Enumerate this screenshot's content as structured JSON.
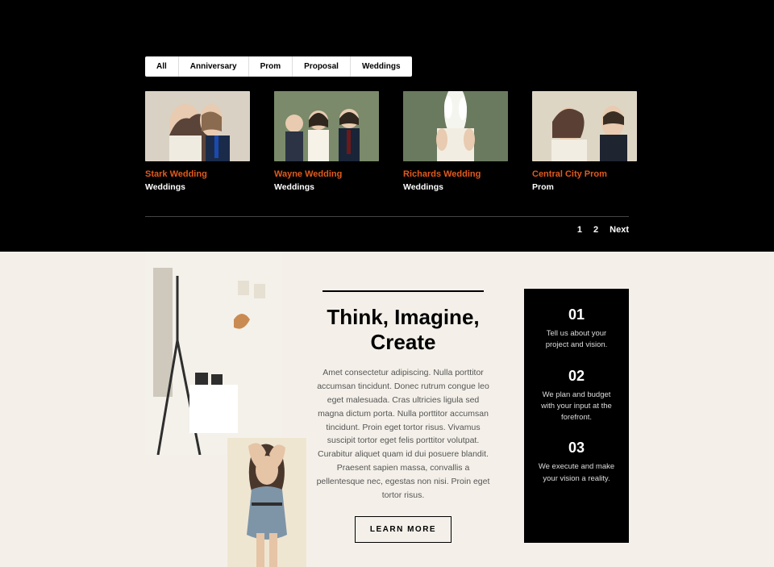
{
  "portfolio": {
    "filters": [
      "All",
      "Anniversary",
      "Prom",
      "Proposal",
      "Weddings"
    ],
    "items": [
      {
        "title": "Stark Wedding",
        "category": "Weddings"
      },
      {
        "title": "Wayne Wedding",
        "category": "Weddings"
      },
      {
        "title": "Richards Wedding",
        "category": "Weddings"
      },
      {
        "title": "Central City Prom",
        "category": "Prom"
      }
    ],
    "pager": {
      "pages": [
        "1",
        "2"
      ],
      "next": "Next"
    }
  },
  "about": {
    "heading": "Think, Imagine, Create",
    "body": "Amet consectetur adipiscing. Nulla porttitor accumsan tincidunt. Donec rutrum congue leo eget malesuada. Cras ultricies ligula sed magna dictum porta. Nulla porttitor accumsan tincidunt. Proin eget tortor risus. Vivamus suscipit tortor eget felis porttitor volutpat. Curabitur aliquet quam id dui posuere blandit. Praesent sapien massa, convallis a pellentesque nec, egestas non nisi. Proin eget tortor risus.",
    "button": "LEARN MORE"
  },
  "steps": [
    {
      "num": "01",
      "text": "Tell us about your project and vision."
    },
    {
      "num": "02",
      "text": "We plan and budget with your input at the forefront."
    },
    {
      "num": "03",
      "text": "We execute and make your vision a reality."
    }
  ]
}
